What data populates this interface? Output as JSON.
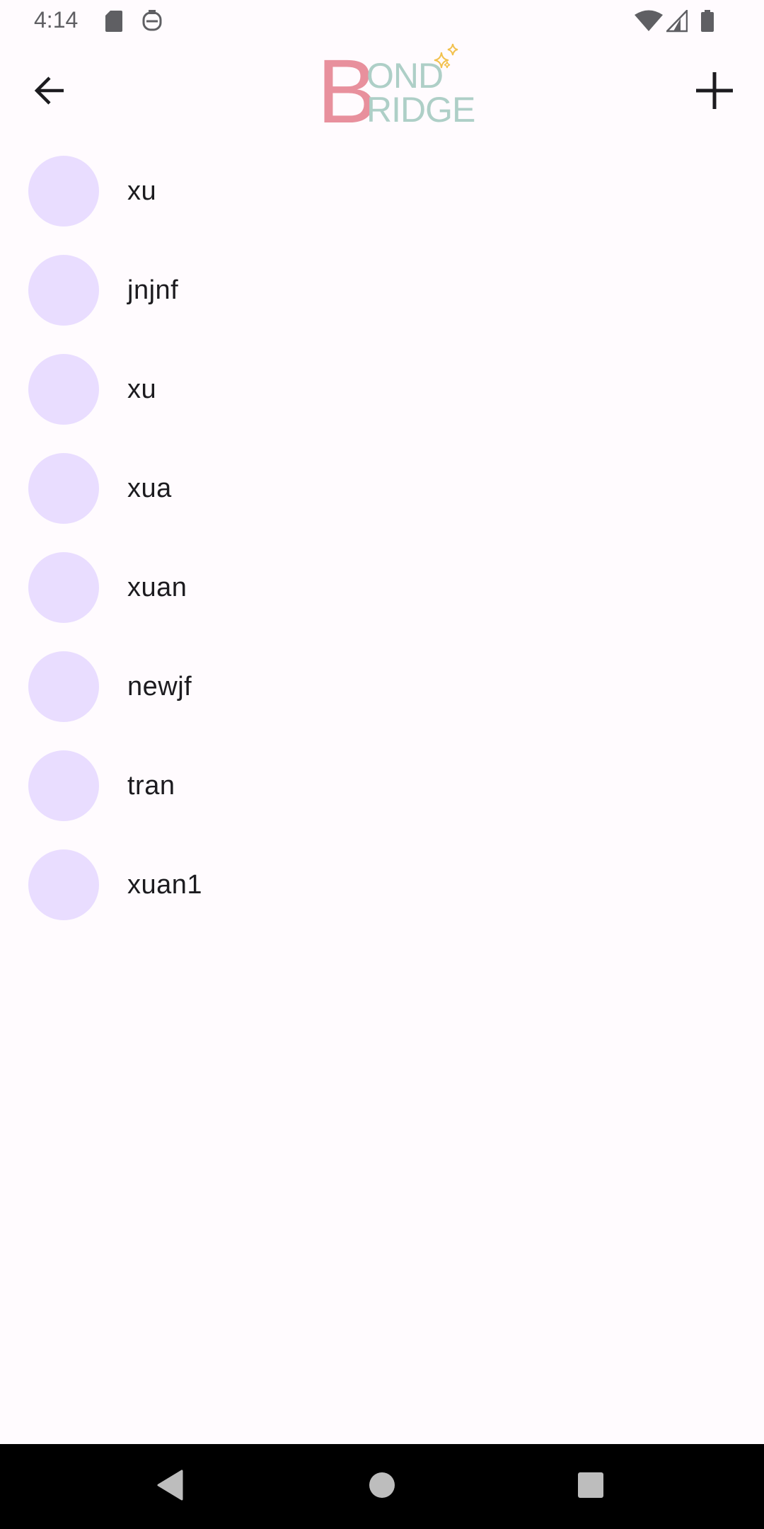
{
  "status_bar": {
    "time": "4:14",
    "icons_left": [
      "sd-card-icon",
      "assistant-icon"
    ],
    "icons_right": [
      "wifi-icon",
      "cell-signal-icon",
      "battery-icon"
    ]
  },
  "app_bar": {
    "back_icon": "arrow-back-icon",
    "add_icon": "plus-icon",
    "logo": {
      "big_letter": "B",
      "line1": "OND",
      "line2": "RIDGE",
      "colors": {
        "letter": "#e8909d",
        "text": "#aecfc7",
        "sparkle": "#f2c14e"
      }
    }
  },
  "contacts": [
    {
      "name": "xu"
    },
    {
      "name": "jnjnf"
    },
    {
      "name": "xu"
    },
    {
      "name": "xua"
    },
    {
      "name": "xuan"
    },
    {
      "name": "newjf"
    },
    {
      "name": "tran"
    },
    {
      "name": "xuan1"
    }
  ],
  "colors": {
    "background": "#fffbfe",
    "avatar": "#e9ddff",
    "text": "#1c1b1f",
    "nav_bar": "#000000"
  },
  "nav_bar": {
    "buttons": [
      "back-triangle-icon",
      "home-circle-icon",
      "recents-square-icon"
    ]
  }
}
